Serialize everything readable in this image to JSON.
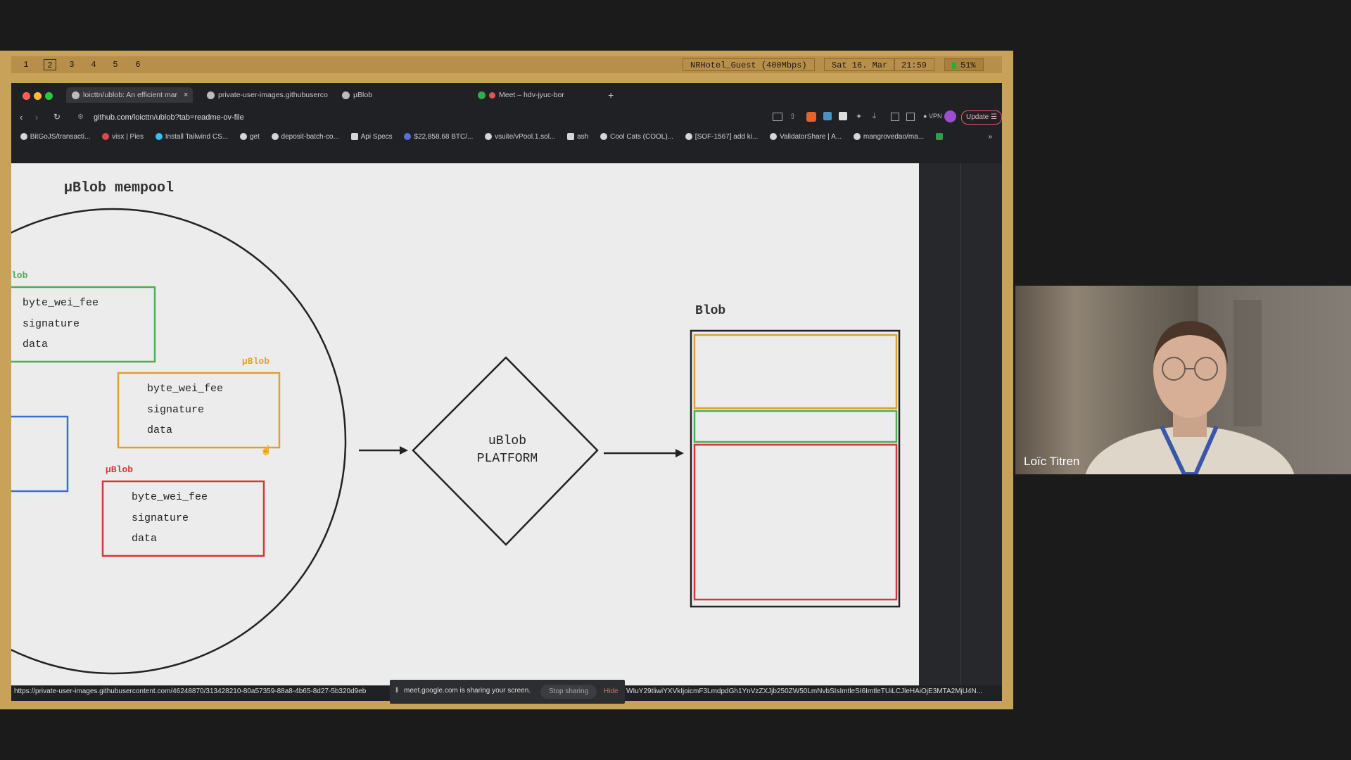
{
  "topbar": {
    "workspaces": [
      "1",
      "2",
      "3",
      "4",
      "5",
      "6"
    ],
    "active_workspace": "2",
    "wifi": "NRHotel_Guest (400Mbps)",
    "date": "Sat 16. Mar",
    "time": "21:59",
    "battery": "51%"
  },
  "browser": {
    "tabs": [
      {
        "label": "loicttn/ublob: An efficient mar"
      },
      {
        "label": "private-user-images.githubuserco"
      },
      {
        "label": "µBlob"
      },
      {
        "label": "Meet – hdv-jyuc-bor"
      }
    ],
    "new_tab": "+",
    "url": "github.com/loicttn/ublob?tab=readme-ov-file",
    "vpn": "VPN",
    "update": "Update",
    "bookmarks": [
      "BitGoJS/transacti...",
      "visx | Pies",
      "Install Tailwind CS...",
      "get",
      "deposit-batch-co...",
      "Api Specs",
      "$22,858.68 BTC/...",
      "vsuite/vPool.1.sol...",
      "ash",
      "Cool Cats (COOL)...",
      "[SOF-1567] add ki...",
      "ValidatorShare | A...",
      "mangrovedao/ma..."
    ],
    "more": "»"
  },
  "diagram": {
    "title": "µBlob mempool",
    "green_label": "lob",
    "orange_label": "µBlob",
    "red_label": "µBlob",
    "fields": [
      "byte_wei_fee",
      "signature",
      "data"
    ],
    "platform_line1": "uBlob",
    "platform_line2": "PLATFORM",
    "blob_label": "Blob",
    "colors": {
      "green": "#4caf50",
      "orange": "#e0a030",
      "red": "#d03a3a",
      "blue": "#3a6fd0",
      "stroke": "#222222"
    }
  },
  "status": {
    "url_left": "https://private-user-images.githubusercontent.com/46248870/313428210-80a57359-88a8-4b65-8d27-5b320d9eb",
    "sharing_text": "meet.google.com is sharing your screen.",
    "stop": "Stop sharing",
    "hide": "Hide",
    "url_right": "WIuY29tliwiYXVkIjoicmF3LmdpdGh1YnVzZXJjb250ZW50LmNvbSIsImtleSI6ImtleTUiLCJleHAiOjE3MTA2MjU4N..."
  },
  "participant": {
    "name": "Loïc Titren"
  }
}
